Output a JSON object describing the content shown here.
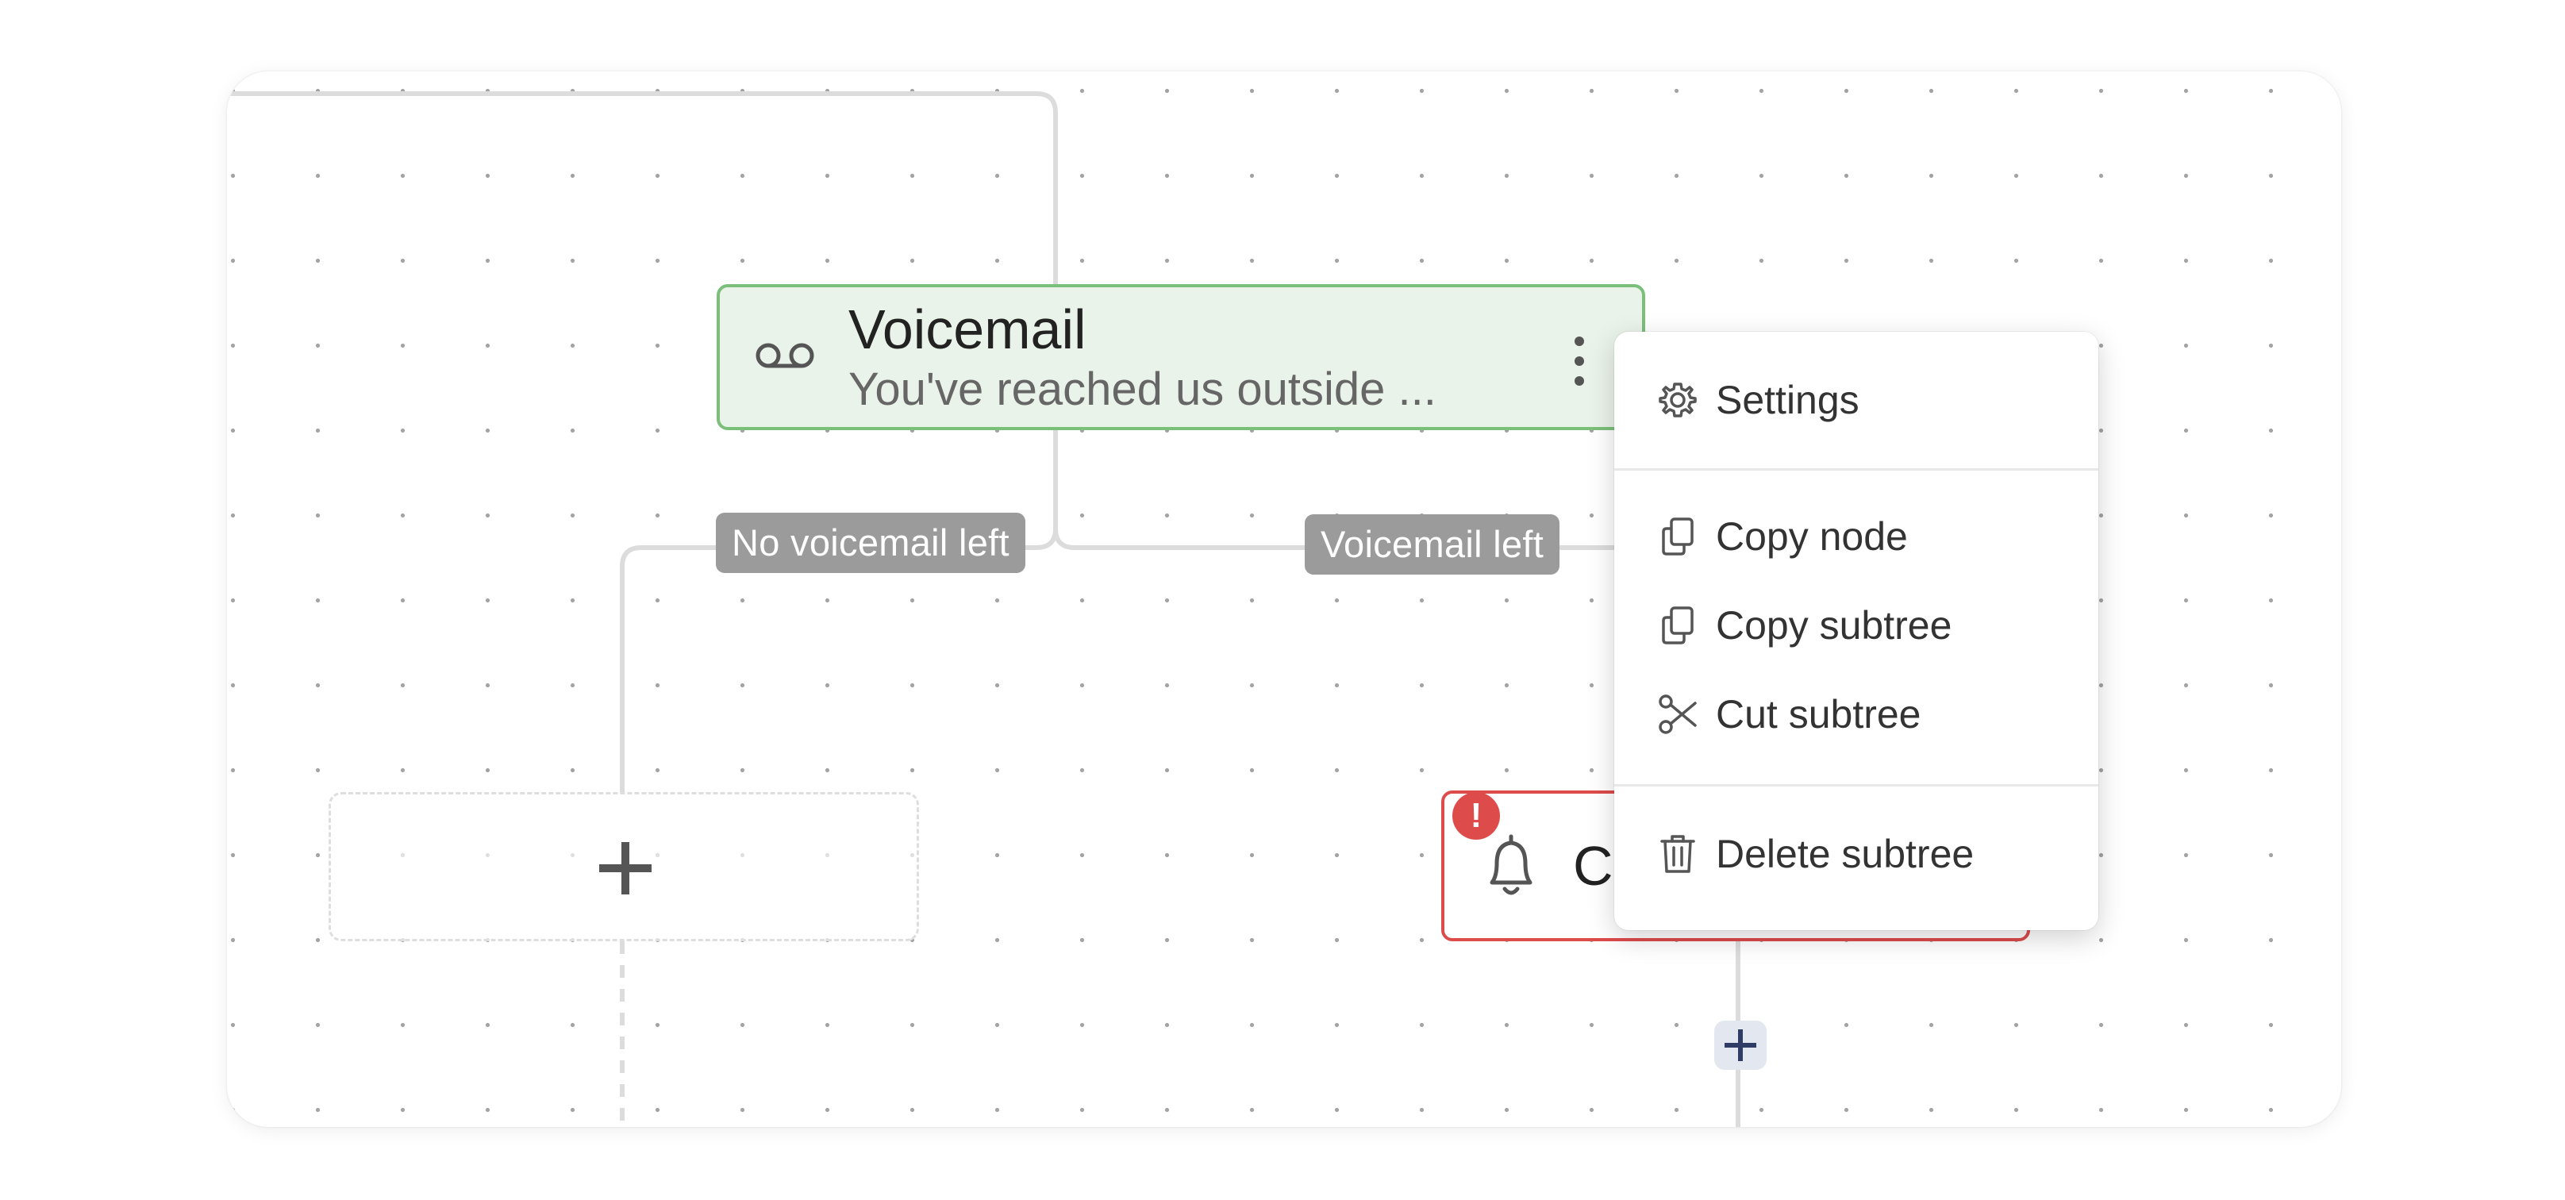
{
  "voicemail_node": {
    "icon": "voicemail-icon",
    "title": "Voicemail",
    "subtitle": "You've reached us outside ..."
  },
  "branch_labels": {
    "no_voicemail": "No voicemail left",
    "voicemail_left": "Voicemail left"
  },
  "alert_node": {
    "icon": "bell-icon",
    "title_visible": "C",
    "error_badge": "!"
  },
  "context_menu": {
    "settings": {
      "label": "Settings",
      "icon": "gear-icon"
    },
    "copy_node": {
      "label": "Copy node",
      "icon": "copy-icon"
    },
    "copy_subtree": {
      "label": "Copy subtree",
      "icon": "copy-icon"
    },
    "cut_subtree": {
      "label": "Cut subtree",
      "icon": "scissors-icon"
    },
    "delete_subtree": {
      "label": "Delete subtree",
      "icon": "trash-icon"
    }
  },
  "colors": {
    "voicemail_border": "#7abf7a",
    "voicemail_bg": "#eaf3ea",
    "error_red": "#dd4b4b",
    "branch_label_bg": "#9b9b9b",
    "add_button_bg": "#e3e7ef"
  }
}
